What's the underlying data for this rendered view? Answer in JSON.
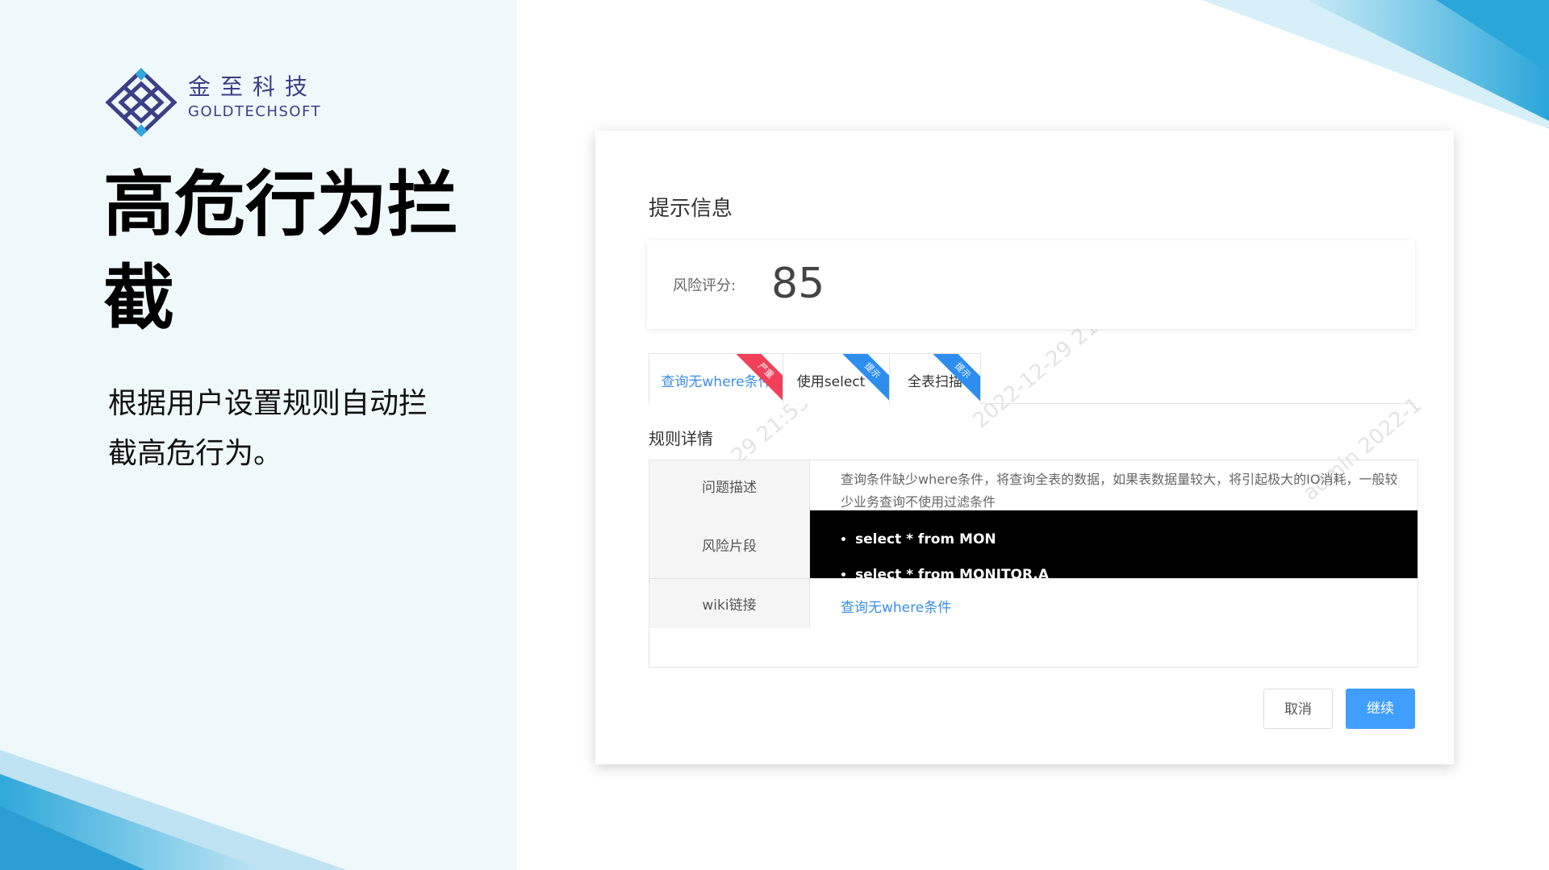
{
  "brand": {
    "name_cn": "金至科技",
    "name_en": "GOLDTECHSOFT",
    "logo_icon": "diamond-lattice-logo-icon"
  },
  "slide": {
    "headline": "高危行为拦截",
    "description": "根据用户设置规则自动拦截高危行为。"
  },
  "colors": {
    "brand_navy": "#3c3f86",
    "accent_blue": "#409eff",
    "deco_blue": "#3ab3e0",
    "ribbon_red": "#f0405a",
    "ribbon_blue": "#2d8ef0"
  },
  "dialog": {
    "title": "提示信息",
    "score_label": "风险评分:",
    "score_value": "85",
    "tabs": [
      {
        "label": "查询无where条件",
        "ribbon": "严重",
        "active": true
      },
      {
        "label": "使用select *",
        "ribbon": "提示",
        "active": false
      },
      {
        "label": "全表扫描",
        "ribbon": "提示",
        "active": false
      }
    ],
    "section_title": "规则详情",
    "rows": {
      "problem_label": "问题描述",
      "problem_text": "查询条件缺少where条件，将查询全表的数据，如果表数据量较大，将引起极大的IO消耗，一般较少业务查询不使用过滤条件",
      "fragment_label": "风险片段",
      "fragments": [
        "select * from MON",
        "select * from MONITOR.A"
      ],
      "wiki_label": "wiki链接",
      "wiki_link": "查询无where条件"
    },
    "buttons": {
      "cancel": "取消",
      "continue": "继续"
    }
  }
}
